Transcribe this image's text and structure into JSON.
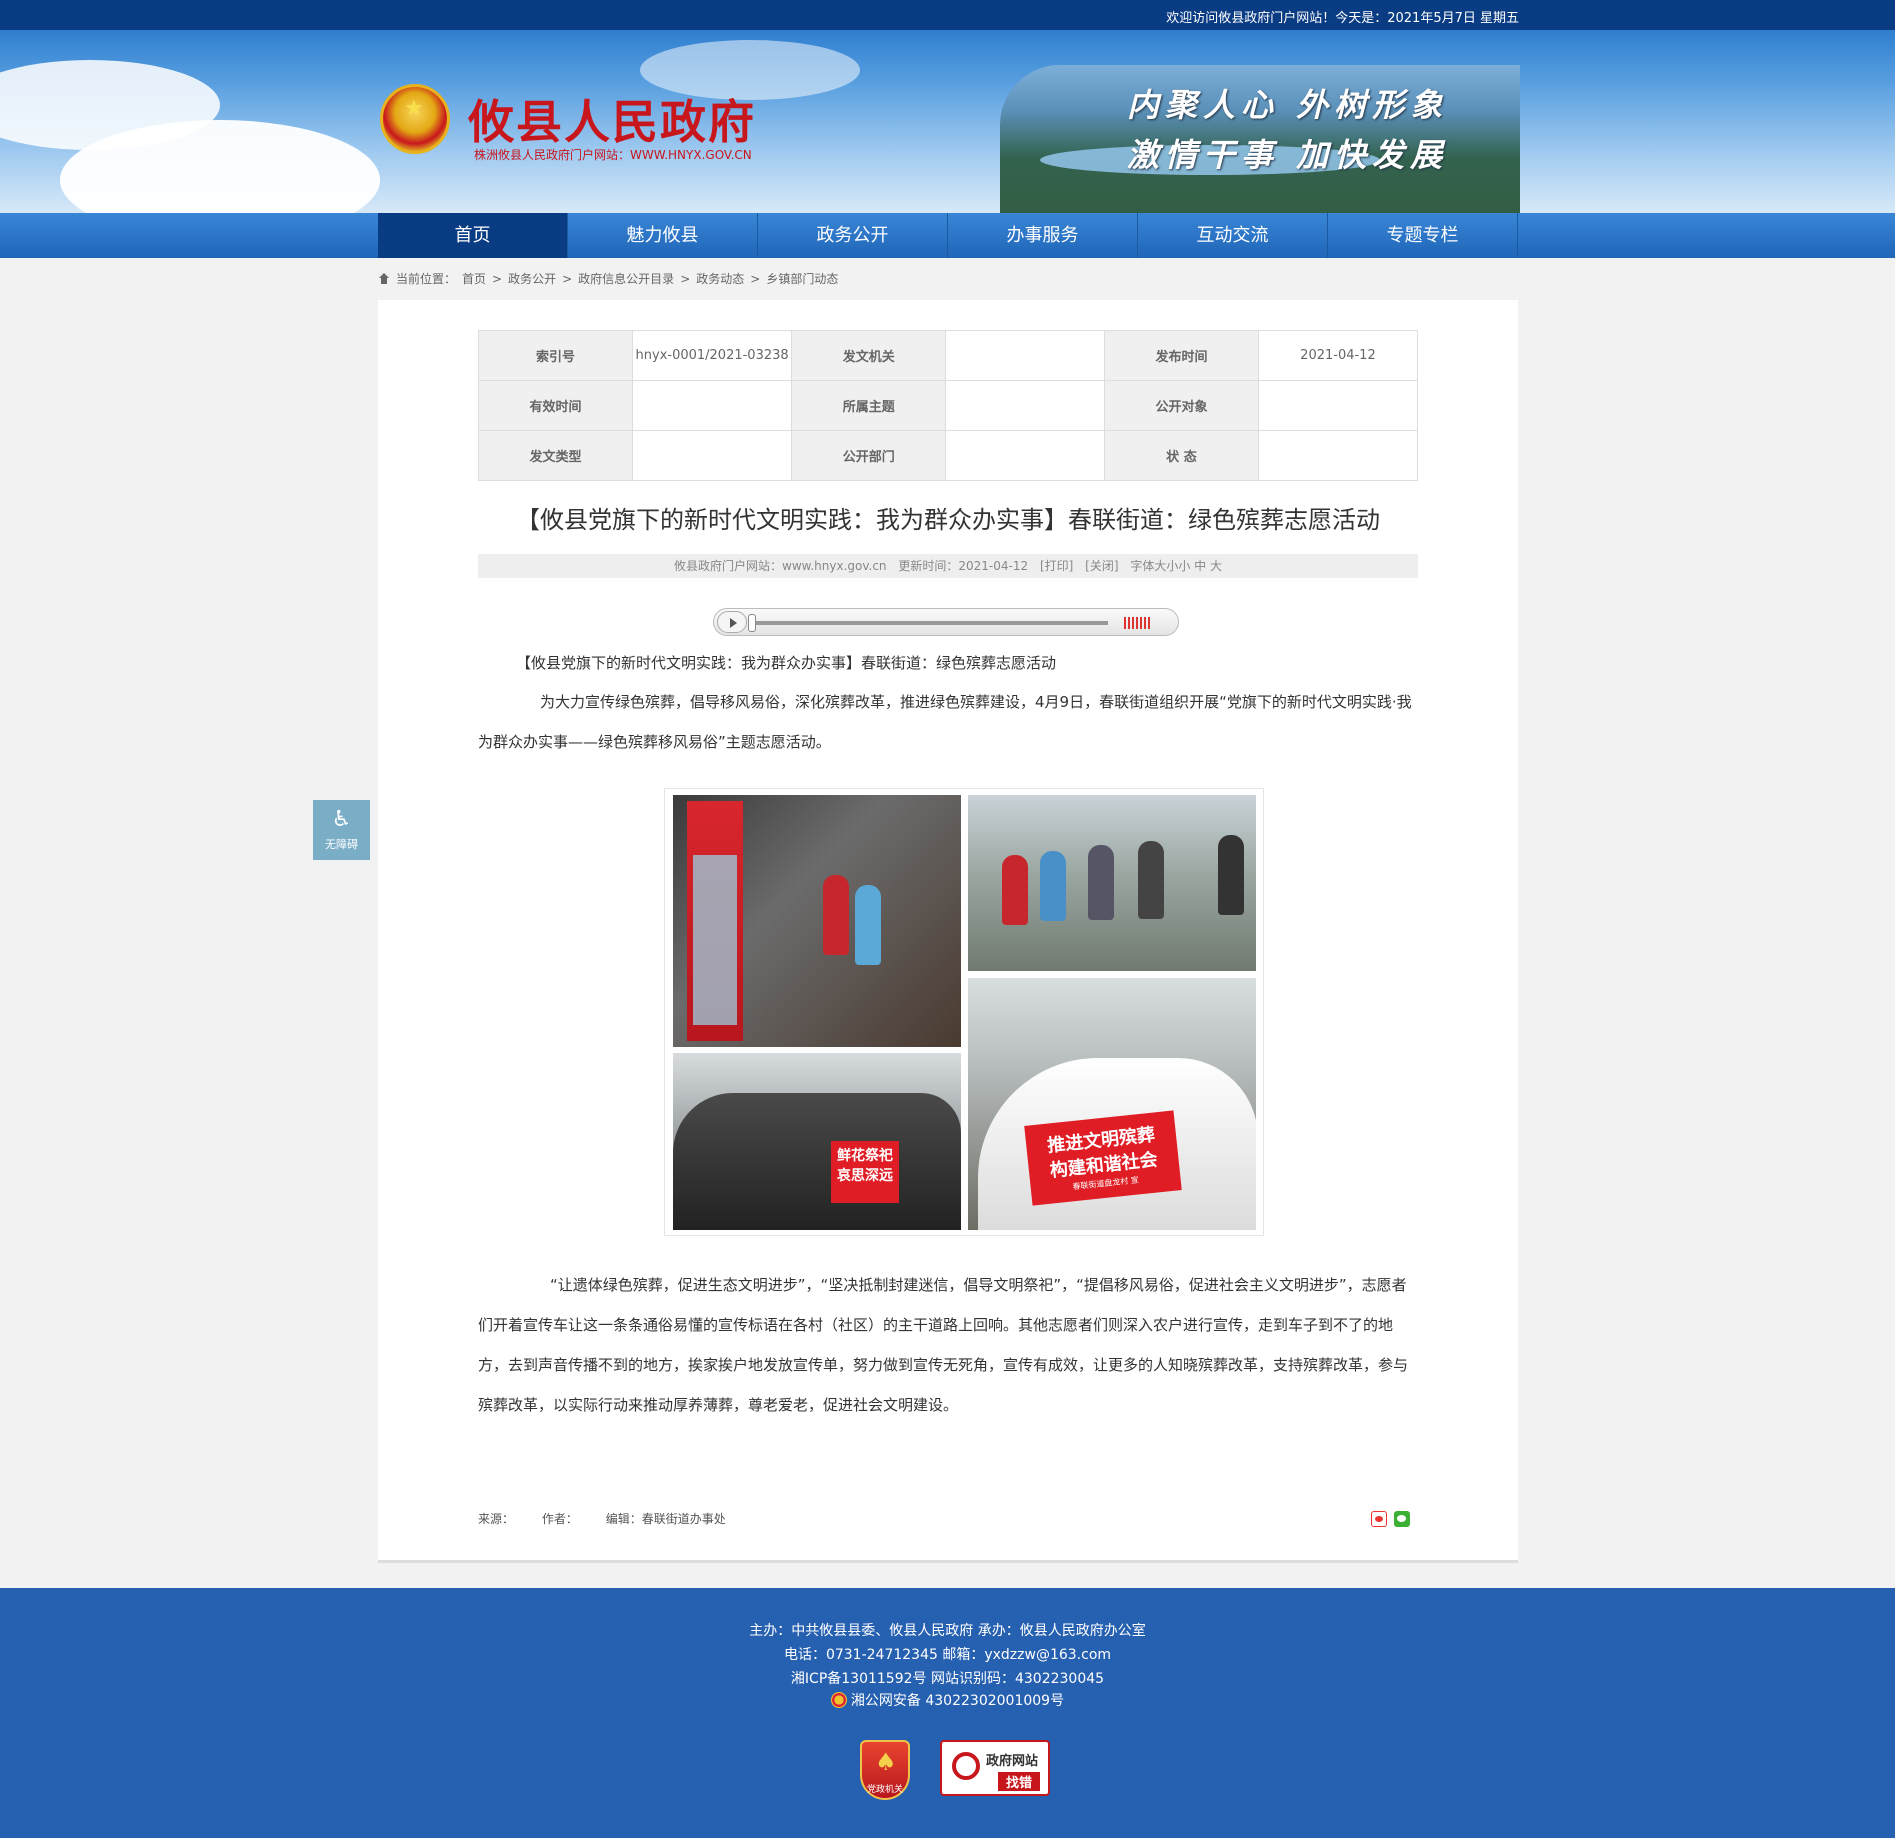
{
  "topbar": {
    "welcome": "欢迎访问攸县政府门户网站！今天是：2021年5月7日 星期五"
  },
  "header": {
    "site_name": "攸县人民政府",
    "site_sub": "株洲攸县人民政府门户网站：WWW.HNYX.GOV.CN",
    "slogan1": "内聚人心  外树形象",
    "slogan2": "激情干事  加快发展"
  },
  "nav": {
    "items": [
      "首页",
      "魅力攸县",
      "政务公开",
      "办事服务",
      "互动交流",
      "专题专栏"
    ],
    "active": 0
  },
  "breadcrumb": {
    "label": "当前位置：",
    "items": [
      "首页",
      "政务公开",
      "政府信息公开目录",
      "政务动态",
      "乡镇部门动态"
    ],
    "sep": ">"
  },
  "meta": {
    "rows": [
      [
        {
          "k": "索引号",
          "v": "hnyx-0001/2021-03238"
        },
        {
          "k": "发文机关",
          "v": ""
        },
        {
          "k": "发布时间",
          "v": "2021-04-12"
        }
      ],
      [
        {
          "k": "有效时间",
          "v": ""
        },
        {
          "k": "所属主题",
          "v": ""
        },
        {
          "k": "公开对象",
          "v": ""
        }
      ],
      [
        {
          "k": "发文类型",
          "v": ""
        },
        {
          "k": "公开部门",
          "v": ""
        },
        {
          "k": "状 态",
          "v": ""
        }
      ]
    ]
  },
  "article": {
    "title": "【攸县党旗下的新时代文明实践：我为群众办实事】春联街道：绿色殡葬志愿活动",
    "source_site": "攸县政府门户网站：www.hnyx.gov.cn",
    "update": "更新时间：2021-04-12",
    "print": "[打印]",
    "close": "[关闭]",
    "font_size": "字体大小小 中 大",
    "lead": "【攸县党旗下的新时代文明实践：我为群众办实事】春联街道：绿色殡葬志愿活动",
    "p1": "为大力宣传绿色殡葬，倡导移风易俗，深化殡葬改革，推进绿色殡葬建设，4月9日，春联街道组织开展“党旗下的新时代文明实践·我为群众办实事——绿色殡葬移风易俗”主题志愿活动。",
    "p2": "“让遗体绿色殡葬，促进生态文明进步”，“坚决抵制封建迷信，倡导文明祭祀”，“提倡移风易俗，促进社会主义文明进步”，志愿者们开着宣传车让这一条条通俗易懂的宣传标语在各村（社区）的主干道路上回响。其他志愿者们则深入农户进行宣传，走到车子到不了的地方，去到声音传播不到的地方，挨家挨户地发放宣传单，努力做到宣传无死角，宣传有成效，让更多的人知晓殡葬改革，支持殡葬改革，参与殡葬改革，以实际行动来推动厚养薄葬，尊老爱老，促进社会文明建设。",
    "sign_left": "鲜花祭祀\n哀思深远",
    "sign_right": "推进文明殡葬\n构建和谐社会",
    "sign_right_small": "春联街道盘龙村 宣",
    "source_label": "来源：",
    "author_label": "作者：",
    "editor": "编辑：春联街道办事处"
  },
  "a11y": {
    "label": "无障碍"
  },
  "footer": {
    "line1": "主办：中共攸县县委、攸县人民政府 承办：攸县人民政府办公室",
    "line2": "电话：0731-24712345 邮箱：yxdzzw@163.com",
    "line3": "湘ICP备13011592号   网站识别码：4302230045",
    "line4": "湘公网安备 43022302001009号",
    "badge_party": "党政机关",
    "badge_err1": "政府网站",
    "badge_err2": "找错"
  }
}
